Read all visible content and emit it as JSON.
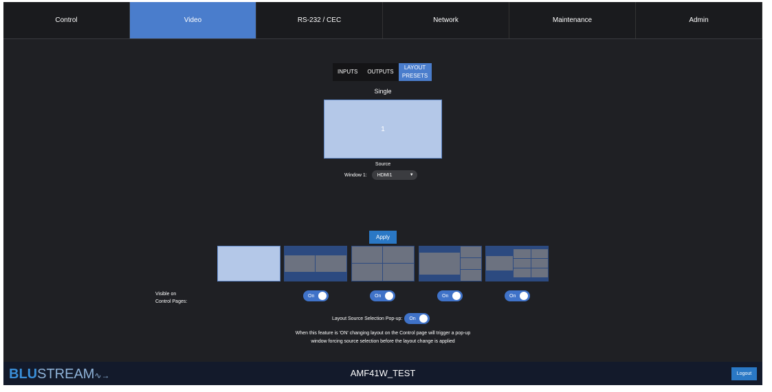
{
  "nav": [
    "Control",
    "Video",
    "RS-232 / CEC",
    "Network",
    "Maintenance",
    "Admin"
  ],
  "subtabs": [
    "INPUTS",
    "OUTPUTS",
    "LAYOUT PRESETS"
  ],
  "layout": {
    "title": "Single",
    "window_number": "1",
    "source_label": "Source",
    "window_label": "Window 1:",
    "window_value": "HDMI1"
  },
  "apply_label": "Apply",
  "visible_label": "Visible on Control Pages:",
  "toggles": [
    "On",
    "On",
    "On",
    "On"
  ],
  "popup_label": "Layout Source Selection Pop-up:",
  "popup_value": "On",
  "note": "When this feature is 'ON' changing layout on the Control page will trigger a pop-up window forcing source selection before the layout change is applied",
  "footer": {
    "logo": "BLUSTREAM",
    "logo_a": "BLU",
    "logo_b": "STREAM",
    "device": "AMF41W_TEST",
    "logout": "Logout"
  }
}
